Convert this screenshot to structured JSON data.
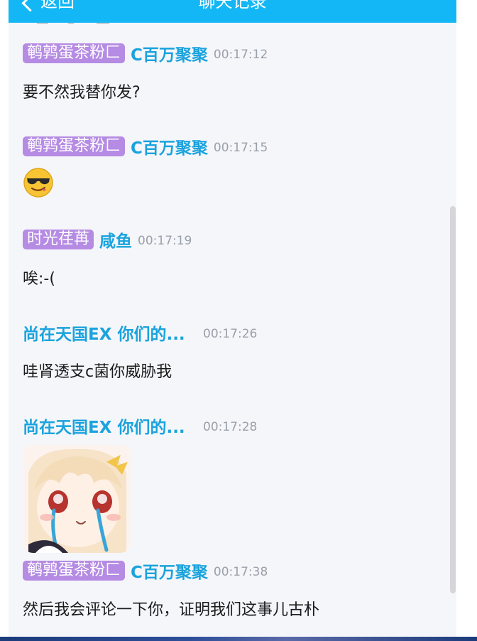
{
  "header": {
    "back_label": "返回",
    "title": "聊天记录",
    "background_color": "#13b7f5"
  },
  "colors": {
    "badge": "#b58be3",
    "name": "#1aa3dd",
    "time": "#9aa0aa",
    "content_bg": "#f5f6fa"
  },
  "messages": [
    {
      "badge": "鹌鹑蛋茶粉匚",
      "name": "C百万聚聚",
      "time": "00:17:12",
      "type": "text",
      "text": "要不然我替你发?"
    },
    {
      "badge": "鹌鹑蛋茶粉匚",
      "name": "C百万聚聚",
      "time": "00:17:15",
      "type": "emoji",
      "icon": "cool-sunglasses-emoji"
    },
    {
      "badge": "时光荏苒",
      "name": "咸鱼",
      "time": "00:17:19",
      "type": "text",
      "text": "唉:-("
    },
    {
      "badge": "",
      "name": "尚在天国EX 你们的...",
      "time": "00:17:26",
      "type": "text",
      "text": "哇肾透支c菌你威胁我"
    },
    {
      "badge": "",
      "name": "尚在天国EX 你们的...",
      "time": "00:17:28",
      "type": "image",
      "icon": "crying-anime-girl-sticker"
    },
    {
      "badge": "鹌鹑蛋茶粉匚",
      "name": "C百万聚聚",
      "time": "00:17:38",
      "type": "text",
      "text": "然后我会评论一下你，证明我们这事儿古朴"
    }
  ]
}
